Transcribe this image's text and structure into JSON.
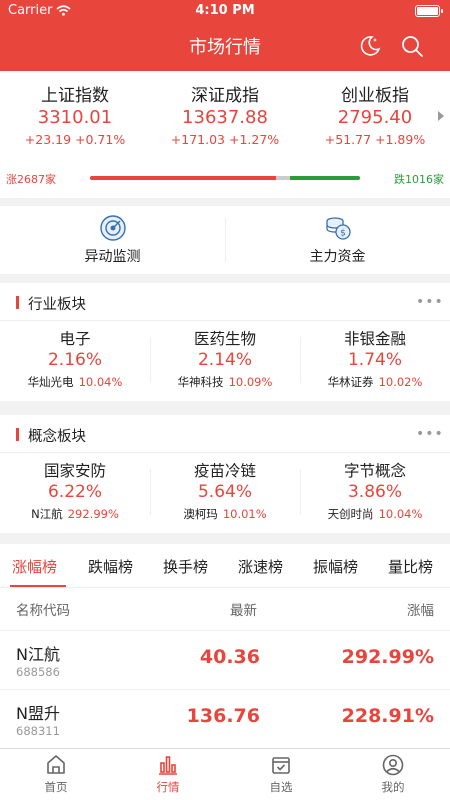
{
  "status": {
    "carrier": "Carrier",
    "time": "4:10 PM"
  },
  "header": {
    "title": "市场行情",
    "night_icon": "moon-icon",
    "search_icon": "search-icon"
  },
  "indices": [
    {
      "name": "上证指数",
      "value": "3310.01",
      "change": "+23.19",
      "pct": "+0.71%"
    },
    {
      "name": "深证成指",
      "value": "13637.88",
      "change": "+171.03",
      "pct": "+1.27%"
    },
    {
      "name": "创业板指",
      "value": "2795.40",
      "change": "+51.77",
      "pct": "+1.89%"
    }
  ],
  "breadth": {
    "up_label": "涨2687家",
    "down_label": "跌1016家",
    "up_fraction": 0.69,
    "down_fraction": 0.26
  },
  "tools": [
    {
      "label": "异动监测",
      "icon": "radar-icon"
    },
    {
      "label": "主力资金",
      "icon": "coins-icon"
    }
  ],
  "industry": {
    "title": "行业板块",
    "more": "•••",
    "items": [
      {
        "name": "电子",
        "pct": "2.16%",
        "leader": "华灿光电",
        "leader_pct": "10.04%"
      },
      {
        "name": "医药生物",
        "pct": "2.14%",
        "leader": "华神科技",
        "leader_pct": "10.09%"
      },
      {
        "name": "非银金融",
        "pct": "1.74%",
        "leader": "华林证券",
        "leader_pct": "10.02%"
      }
    ]
  },
  "concept": {
    "title": "概念板块",
    "more": "•••",
    "items": [
      {
        "name": "国家安防",
        "pct": "6.22%",
        "leader": "N江航",
        "leader_pct": "292.99%"
      },
      {
        "name": "疫苗冷链",
        "pct": "5.64%",
        "leader": "澳柯玛",
        "leader_pct": "10.01%"
      },
      {
        "name": "字节概念",
        "pct": "3.86%",
        "leader": "天创时尚",
        "leader_pct": "10.04%"
      }
    ]
  },
  "rank_tabs": [
    "涨幅榜",
    "跌幅榜",
    "换手榜",
    "涨速榜",
    "振幅榜",
    "量比榜"
  ],
  "table": {
    "headers": {
      "name": "名称代码",
      "price": "最新",
      "pct": "涨幅"
    },
    "rows": [
      {
        "name": "N江航",
        "code": "688586",
        "price": "40.36",
        "pct": "292.99%"
      },
      {
        "name": "N盟升",
        "code": "688311",
        "price": "136.76",
        "pct": "228.91%"
      }
    ]
  },
  "nav": [
    {
      "label": "首页",
      "icon": "home-icon"
    },
    {
      "label": "行情",
      "icon": "bar-chart-icon"
    },
    {
      "label": "自选",
      "icon": "watchlist-icon"
    },
    {
      "label": "我的",
      "icon": "profile-icon"
    }
  ],
  "colors": {
    "accent": "#e8453c",
    "up": "#e8453c",
    "down": "#2a9d3a"
  }
}
